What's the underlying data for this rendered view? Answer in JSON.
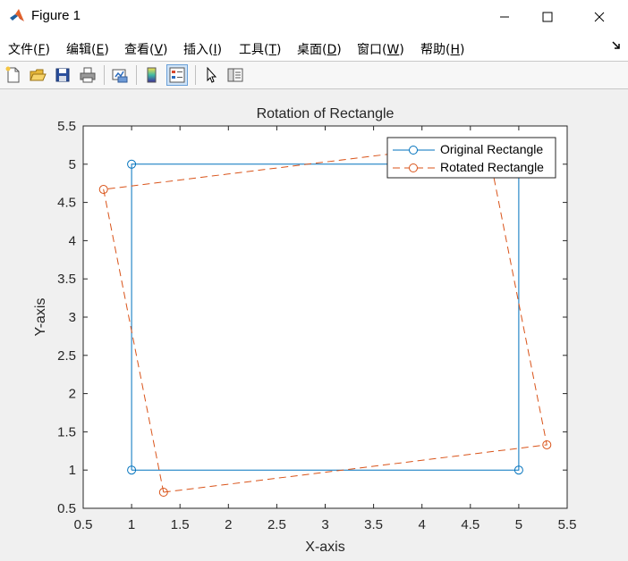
{
  "window": {
    "title": "Figure 1",
    "minimize_icon": "minimize-icon",
    "maximize_icon": "maximize-icon",
    "close_icon": "close-icon"
  },
  "menubar": {
    "items": [
      {
        "label": "文件",
        "key": "F"
      },
      {
        "label": "编辑",
        "key": "E"
      },
      {
        "label": "查看",
        "key": "V"
      },
      {
        "label": "插入",
        "key": "I"
      },
      {
        "label": "工具",
        "key": "T"
      },
      {
        "label": "桌面",
        "key": "D"
      },
      {
        "label": "窗口",
        "key": "W"
      },
      {
        "label": "帮助",
        "key": "H"
      }
    ]
  },
  "toolbar": {
    "buttons": [
      "new-figure-icon",
      "open-file-icon",
      "save-icon",
      "print-icon",
      "link-plot-icon",
      "colorbar-icon",
      "legend-icon",
      "pointer-icon",
      "property-editor-icon"
    ]
  },
  "chart_data": {
    "type": "line",
    "title": "Rotation of Rectangle",
    "xlabel": "X-axis",
    "ylabel": "Y-axis",
    "xlim": [
      0.5,
      5.5
    ],
    "ylim": [
      0.5,
      5.5
    ],
    "xticks": [
      "0.5",
      "1",
      "1.5",
      "2",
      "2.5",
      "3",
      "3.5",
      "4",
      "4.5",
      "5",
      "5.5"
    ],
    "yticks": [
      "0.5",
      "1",
      "1.5",
      "2",
      "2.5",
      "3",
      "3.5",
      "4",
      "4.5",
      "5",
      "5.5"
    ],
    "legend_position": "top-right",
    "grid": false,
    "series": [
      {
        "name": "Original Rectangle",
        "color": "#0072BD",
        "linestyle": "solid",
        "marker": "circle",
        "x": [
          1,
          5,
          5,
          1,
          1
        ],
        "y": [
          1,
          1,
          5,
          5,
          1
        ]
      },
      {
        "name": "Rotated Rectangle",
        "color": "#D95319",
        "linestyle": "dashed",
        "marker": "circle",
        "x": [
          1.33,
          5.29,
          4.67,
          0.71,
          1.33
        ],
        "y": [
          0.71,
          1.33,
          5.29,
          4.67,
          0.71
        ]
      }
    ]
  }
}
